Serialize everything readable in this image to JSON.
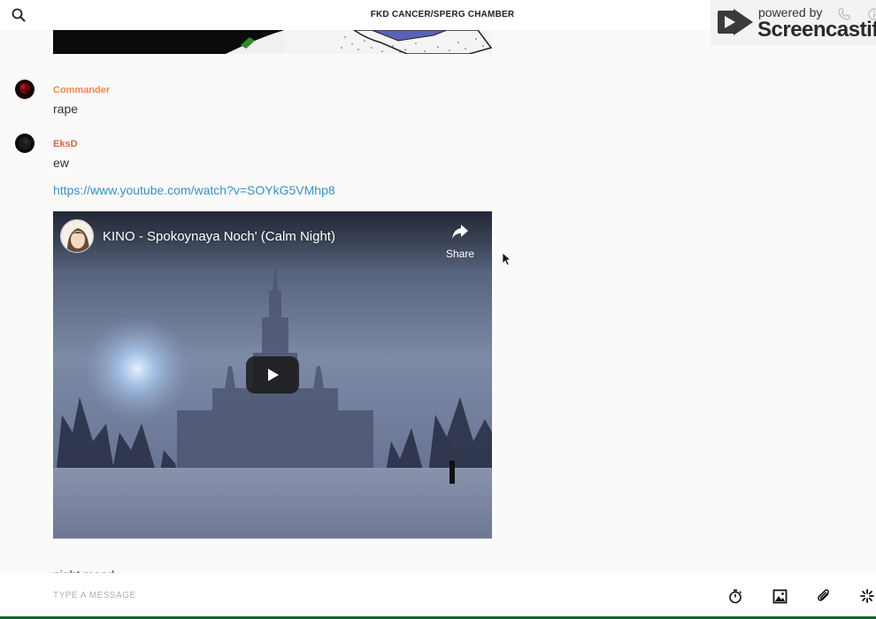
{
  "header": {
    "title": "FKD CANCER/SPERG CHAMBER",
    "search_icon": "search-icon"
  },
  "watermark": {
    "powered_by": "powered by",
    "brand": "Screencastify"
  },
  "messages": [
    {
      "username": "Commander",
      "username_color": "#f08a4b",
      "text": "rape"
    },
    {
      "username": "EksD",
      "username_color": "#e0623f",
      "text": "ew",
      "link": "https://www.youtube.com/watch?v=SOYkG5VMhp8"
    }
  ],
  "video": {
    "title": "KINO - Spokoynaya Noch' (Calm Night)",
    "share_label": "Share"
  },
  "partial_message": "night mood",
  "composer": {
    "placeholder": "TYPE A MESSAGE",
    "tools": [
      "timer-icon",
      "image-icon",
      "attachment-icon",
      "sparkle-icon"
    ]
  },
  "colors": {
    "link": "#3a8fc7",
    "composer_border": "#1e5f2b"
  }
}
